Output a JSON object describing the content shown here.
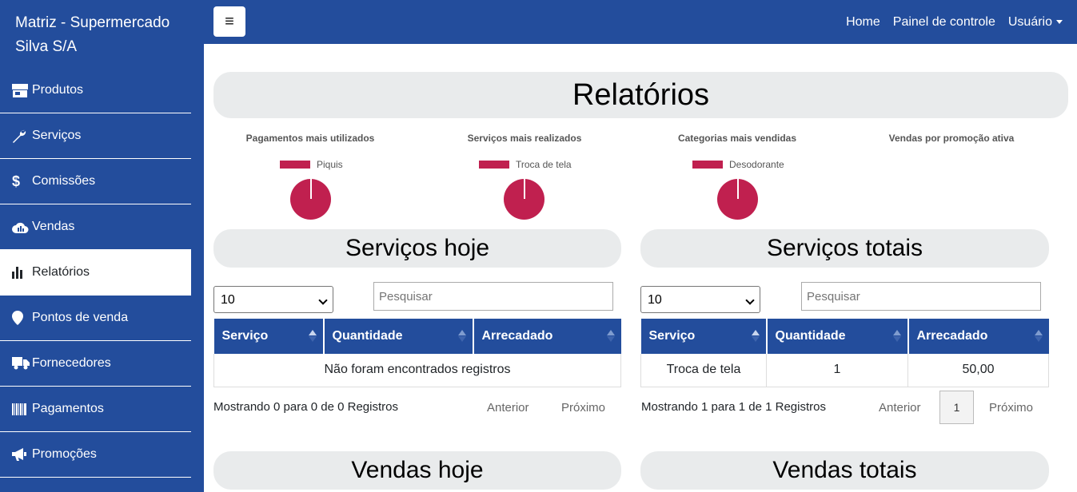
{
  "sidebar": {
    "brand": "Matriz - Supermercado Silva S/A",
    "items": [
      {
        "label": "Produtos",
        "icon": "store-icon"
      },
      {
        "label": "Serviços",
        "icon": "wrench-icon"
      },
      {
        "label": "Comissões",
        "icon": "dollar-icon"
      },
      {
        "label": "Vendas",
        "icon": "cloud-chart-icon"
      },
      {
        "label": "Relatórios",
        "icon": "bar-chart-icon"
      },
      {
        "label": "Pontos de venda",
        "icon": "map-marker-icon"
      },
      {
        "label": "Fornecedores",
        "icon": "truck-icon"
      },
      {
        "label": "Pagamentos",
        "icon": "barcode-icon"
      },
      {
        "label": "Promoções",
        "icon": "megaphone-icon"
      }
    ]
  },
  "topbar": {
    "toggle": "≡",
    "home": "Home",
    "panel": "Painel de controle",
    "user": "Usuário"
  },
  "page": {
    "title": "Relatórios"
  },
  "charts_row": [
    {
      "title": "Pagamentos mais utilizados",
      "legend": "Piquis"
    },
    {
      "title": "Serviços mais realizados",
      "legend": "Troca de tela"
    },
    {
      "title": "Categorias mais vendidas",
      "legend": "Desodorante"
    },
    {
      "title": "Vendas por promoção ativa",
      "legend": ""
    }
  ],
  "chart_data": [
    {
      "type": "pie",
      "title": "Pagamentos mais utilizados",
      "labels": [
        "Piquis"
      ],
      "values": [
        1
      ],
      "colors": [
        "#c0204f"
      ]
    },
    {
      "type": "pie",
      "title": "Serviços mais realizados",
      "labels": [
        "Troca de tela"
      ],
      "values": [
        1
      ],
      "colors": [
        "#c0204f"
      ]
    },
    {
      "type": "pie",
      "title": "Categorias mais vendidas",
      "labels": [
        "Desodorante"
      ],
      "values": [
        1
      ],
      "colors": [
        "#c0204f"
      ]
    },
    {
      "type": "pie",
      "title": "Vendas por promoção ativa",
      "labels": [],
      "values": []
    }
  ],
  "servicos_hoje": {
    "title": "Serviços hoje",
    "page_size": "10",
    "search_placeholder": "Pesquisar",
    "columns": [
      "Serviço",
      "Quantidade",
      "Arrecadado"
    ],
    "empty": "Não foram encontrados registros",
    "info": "Mostrando 0 para 0 de 0 Registros",
    "prev": "Anterior",
    "next": "Próximo"
  },
  "servicos_totais": {
    "title": "Serviços totais",
    "page_size": "10",
    "search_placeholder": "Pesquisar",
    "columns": [
      "Serviço",
      "Quantidade",
      "Arrecadado"
    ],
    "rows": [
      [
        "Troca de tela",
        "1",
        "50,00"
      ]
    ],
    "info": "Mostrando 1 para 1 de 1 Registros",
    "prev": "Anterior",
    "page": "1",
    "next": "Próximo"
  },
  "vendas_hoje": {
    "title": "Vendas hoje"
  },
  "vendas_totais": {
    "title": "Vendas totais"
  },
  "colors": {
    "primary": "#234d9c",
    "chart": "#c0204f",
    "pill": "#e9ebec"
  }
}
